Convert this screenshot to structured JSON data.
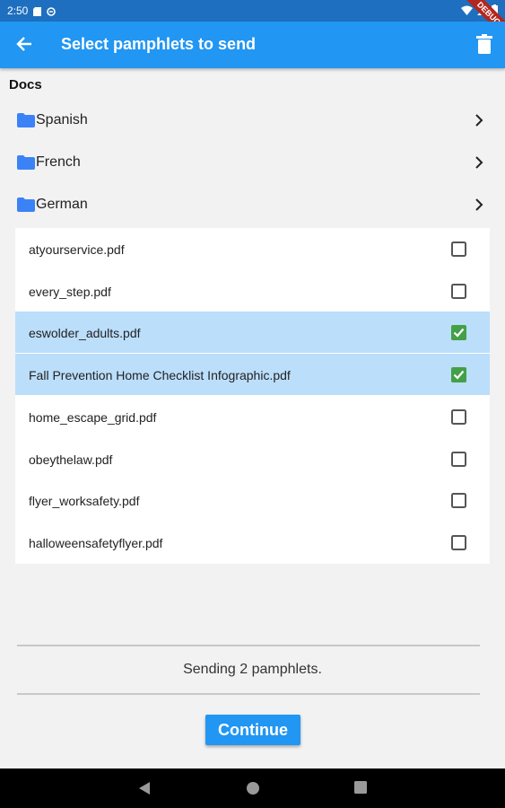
{
  "status_bar": {
    "time": "2:50",
    "debug_label": "DEBUG"
  },
  "app_bar": {
    "title": "Select pamphlets to send"
  },
  "section": {
    "title": "Docs"
  },
  "folders": [
    {
      "label": "Spanish"
    },
    {
      "label": "French"
    },
    {
      "label": "German"
    }
  ],
  "files": [
    {
      "name": "atyourservice.pdf",
      "checked": false
    },
    {
      "name": "every_step.pdf",
      "checked": false
    },
    {
      "name": "eswolder_adults.pdf",
      "checked": true
    },
    {
      "name": "Fall Prevention Home Checklist Infographic.pdf",
      "checked": true
    },
    {
      "name": "home_escape_grid.pdf",
      "checked": false
    },
    {
      "name": "obeythelaw.pdf",
      "checked": false
    },
    {
      "name": "flyer_worksafety.pdf",
      "checked": false
    },
    {
      "name": "halloweensafetyflyer.pdf",
      "checked": false
    }
  ],
  "footer": {
    "status_text": "Sending 2 pamphlets.",
    "continue_label": "Continue"
  },
  "colors": {
    "primary": "#2196f3",
    "selected_row": "#bbdefb",
    "checkbox_checked": "#43a047",
    "folder_icon": "#3b82f6"
  }
}
